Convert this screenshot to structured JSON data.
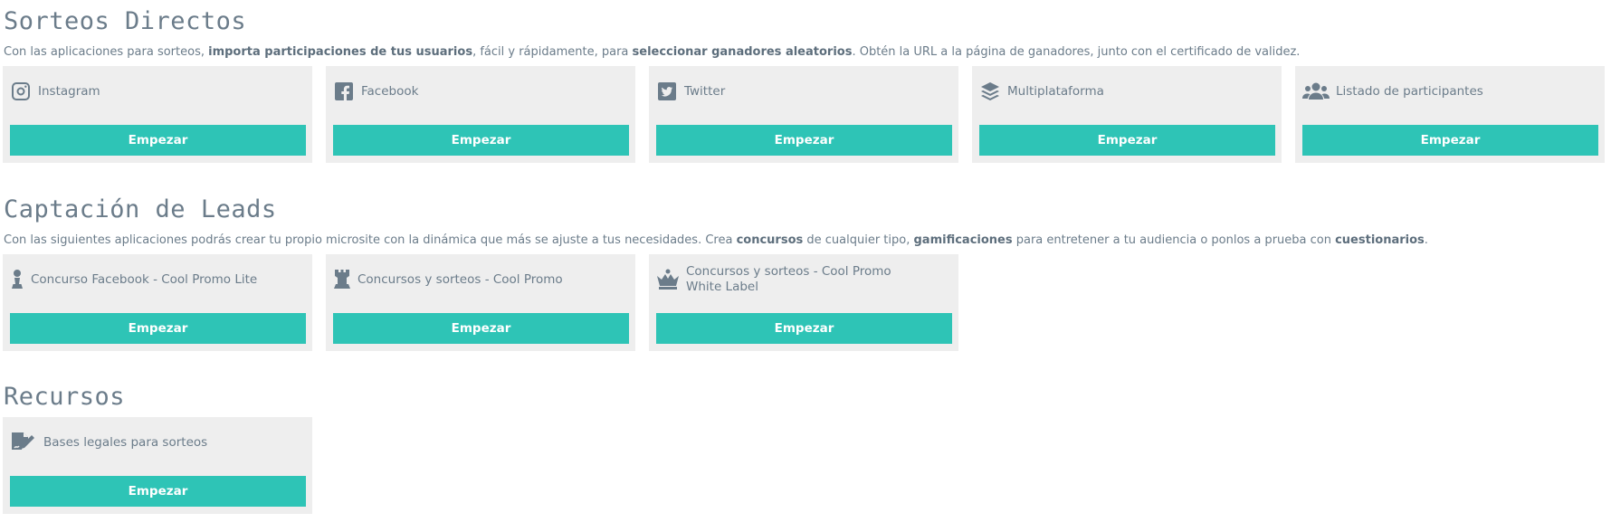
{
  "colors": {
    "accent": "#2ec4b6",
    "card_bg": "#eeeeee",
    "text": "#6b7c8a"
  },
  "sections": [
    {
      "title": "Sorteos Directos",
      "desc": [
        {
          "t": "Con las aplicaciones para sorteos, ",
          "b": false
        },
        {
          "t": "importa participaciones de tus usuarios",
          "b": true
        },
        {
          "t": ", fácil y rápidamente, para ",
          "b": false
        },
        {
          "t": "seleccionar ganadores aleatorios",
          "b": true
        },
        {
          "t": ". Obtén la URL a la página de ganadores, junto con el certificado de validez.",
          "b": false
        }
      ],
      "cards": [
        {
          "icon": "instagram-icon",
          "label": "Instagram",
          "button": "Empezar"
        },
        {
          "icon": "facebook-icon",
          "label": "Facebook",
          "button": "Empezar"
        },
        {
          "icon": "twitter-icon",
          "label": "Twitter",
          "button": "Empezar"
        },
        {
          "icon": "layers-icon",
          "label": "Multiplataforma",
          "button": "Empezar"
        },
        {
          "icon": "users-icon",
          "label": "Listado de participantes",
          "button": "Empezar"
        }
      ]
    },
    {
      "title": "Captación de Leads",
      "desc": [
        {
          "t": "Con las siguientes aplicaciones podrás crear tu propio microsite con la dinámica que más se ajuste a tus necesidades. Crea ",
          "b": false
        },
        {
          "t": "concursos",
          "b": true
        },
        {
          "t": " de cualquier tipo, ",
          "b": false
        },
        {
          "t": "gamificaciones",
          "b": true
        },
        {
          "t": " para entretener a tu audiencia o ponlos a prueba con ",
          "b": false
        },
        {
          "t": "cuestionarios",
          "b": true
        },
        {
          "t": ".",
          "b": false
        }
      ],
      "cards": [
        {
          "icon": "chess-pawn-icon",
          "label": "Concurso Facebook - Cool Promo Lite",
          "button": "Empezar"
        },
        {
          "icon": "chess-rook-icon",
          "label": "Concursos y sorteos - Cool Promo",
          "button": "Empezar"
        },
        {
          "icon": "chess-queen-icon",
          "label": "Concursos y sorteos - Cool Promo White Label",
          "button": "Empezar"
        }
      ]
    },
    {
      "title": "Recursos",
      "desc": [],
      "cards": [
        {
          "icon": "file-signature-icon",
          "label": "Bases legales para sorteos",
          "button": "Empezar"
        }
      ]
    }
  ]
}
